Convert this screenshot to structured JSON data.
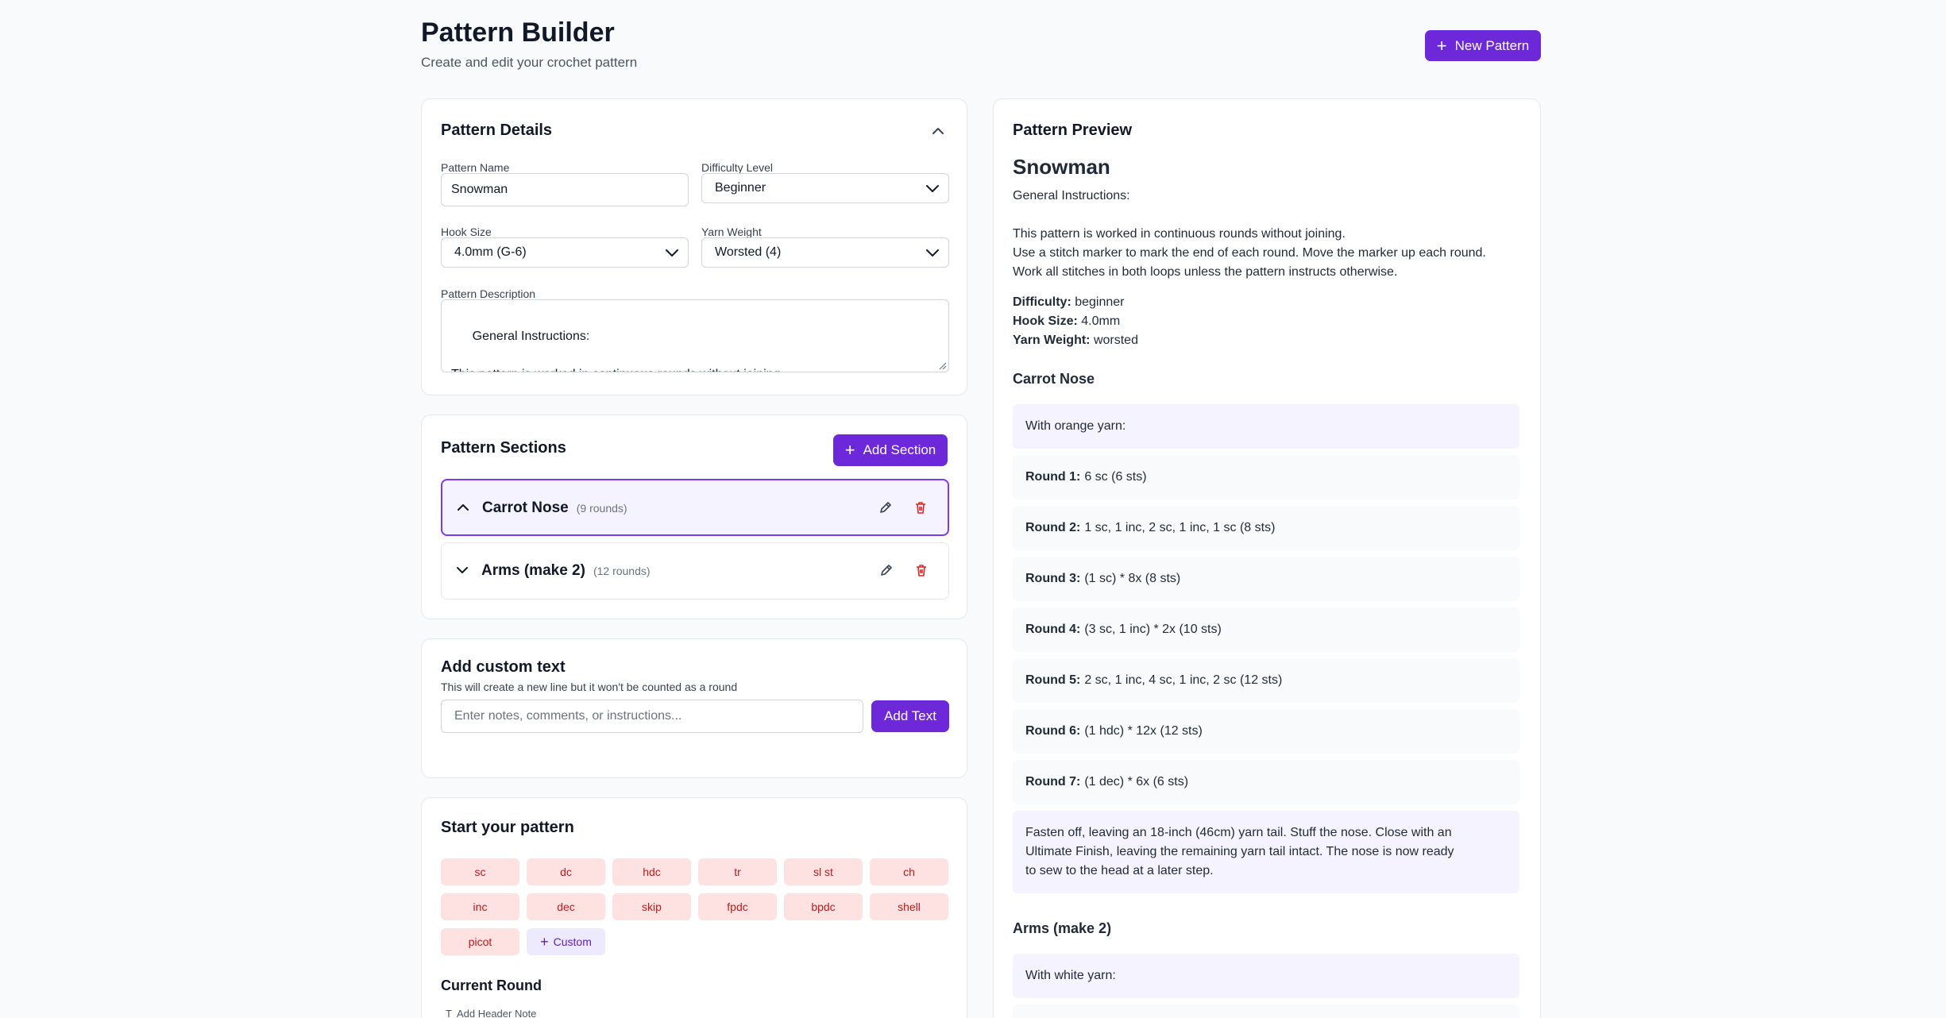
{
  "header": {
    "title": "Pattern Builder",
    "subtitle": "Create and edit your crochet pattern",
    "new_pattern_label": "New Pattern"
  },
  "details": {
    "title": "Pattern Details",
    "name_label": "Pattern Name",
    "name_value": "Snowman",
    "difficulty_label": "Difficulty Level",
    "difficulty_value": "Beginner",
    "hook_label": "Hook Size",
    "hook_value": "4.0mm (G-6)",
    "yarn_label": "Yarn Weight",
    "yarn_value": "Worsted (4)",
    "description_label": "Pattern Description",
    "description_value": "General Instructions:\n\nThis pattern is worked in continuous rounds without joining.\nUse a stitch marker to mark the end of each round. Move the marker up each round."
  },
  "sections": {
    "title": "Pattern Sections",
    "add_label": "Add Section",
    "items": [
      {
        "name": "Carrot Nose",
        "count": "(9 rounds)"
      },
      {
        "name": "Arms (make 2)",
        "count": "(12 rounds)"
      }
    ]
  },
  "custom": {
    "title": "Add custom text",
    "subtitle": "This will create a new line but it won't be counted as a round",
    "placeholder": "Enter notes, comments, or instructions...",
    "button_label": "Add Text"
  },
  "start": {
    "title": "Start your pattern",
    "stitches": [
      "sc",
      "dc",
      "hdc",
      "tr",
      "sl st",
      "ch",
      "inc",
      "dec",
      "skip",
      "fpdc",
      "bpdc",
      "shell",
      "picot"
    ],
    "custom_label": "Custom",
    "current_round_title": "Current Round",
    "header_note_label": "Add Header Note"
  },
  "preview": {
    "title": "Pattern Preview",
    "name": "Snowman",
    "description": "General Instructions:\n\nThis pattern is worked in continuous rounds without joining.\nUse a stitch marker to mark the end of each round. Move the marker up each round.\nWork all stitches in both loops unless the pattern instructs otherwise.",
    "difficulty_label": "Difficulty:",
    "difficulty_value": "beginner",
    "hook_label": "Hook Size:",
    "hook_value": "4.0mm",
    "yarn_label": "Yarn Weight:",
    "yarn_value": "worsted",
    "section1_title": "Carrot Nose",
    "section1_lines": [
      {
        "label": "",
        "text": "With orange yarn:"
      },
      {
        "label": "Round 1:",
        "text": "6 sc (6 sts)"
      },
      {
        "label": "Round 2:",
        "text": "1 sc, 1 inc, 2 sc, 1 inc, 1 sc (8 sts)"
      },
      {
        "label": "Round 3:",
        "text": "(1 sc) * 8x (8 sts)"
      },
      {
        "label": "Round 4:",
        "text": "(3 sc, 1 inc) * 2x (10 sts)"
      },
      {
        "label": "Round 5:",
        "text": "2 sc, 1 inc, 4 sc, 1 inc, 2 sc (12 sts)"
      },
      {
        "label": "Round 6:",
        "text": "(1 hdc) * 12x (12 sts)"
      },
      {
        "label": "Round 7:",
        "text": "(1 dec) * 6x (6 sts)"
      },
      {
        "label": "",
        "text": "Fasten off, leaving an 18-inch (46cm) yarn tail. Stuff the nose. Close with an\nUltimate Finish, leaving the remaining yarn tail intact. The nose is now ready\nto sew to the head at a later step."
      }
    ],
    "section2_title": "Arms (make 2)",
    "section2_lines": [
      {
        "label": "",
        "text": "With white yarn:"
      }
    ]
  }
}
